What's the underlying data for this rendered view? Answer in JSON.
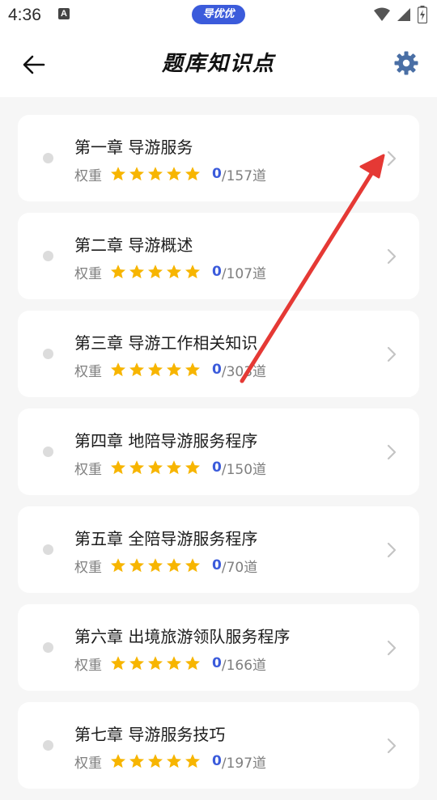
{
  "status_bar": {
    "time": "4:36",
    "notification_icon": "text-a-icon",
    "app_badge": "导优优",
    "icons": [
      "wifi-icon",
      "signal-icon",
      "battery-icon"
    ]
  },
  "header": {
    "back_icon": "arrow-left-icon",
    "title": "题库知识点",
    "settings_icon": "gear-icon"
  },
  "weight_label": "权重",
  "colors": {
    "accent": "#3b5bdb",
    "star": "#f7b500",
    "gear": "#4a6fa5",
    "annotation": "#e53935"
  },
  "chapters": [
    {
      "title": "第一章  导游服务",
      "stars": 5,
      "done": "0",
      "total": "/157道"
    },
    {
      "title": "第二章  导游概述",
      "stars": 5,
      "done": "0",
      "total": "/107道"
    },
    {
      "title": "第三章  导游工作相关知识",
      "stars": 5,
      "done": "0",
      "total": "/303道"
    },
    {
      "title": "第四章  地陪导游服务程序",
      "stars": 5,
      "done": "0",
      "total": "/150道"
    },
    {
      "title": "第五章  全陪导游服务程序",
      "stars": 5,
      "done": "0",
      "total": "/70道"
    },
    {
      "title": "第六章  出境旅游领队服务程序",
      "stars": 5,
      "done": "0",
      "total": "/166道"
    },
    {
      "title": "第七章  导游服务技巧",
      "stars": 5,
      "done": "0",
      "total": "/197道"
    }
  ]
}
